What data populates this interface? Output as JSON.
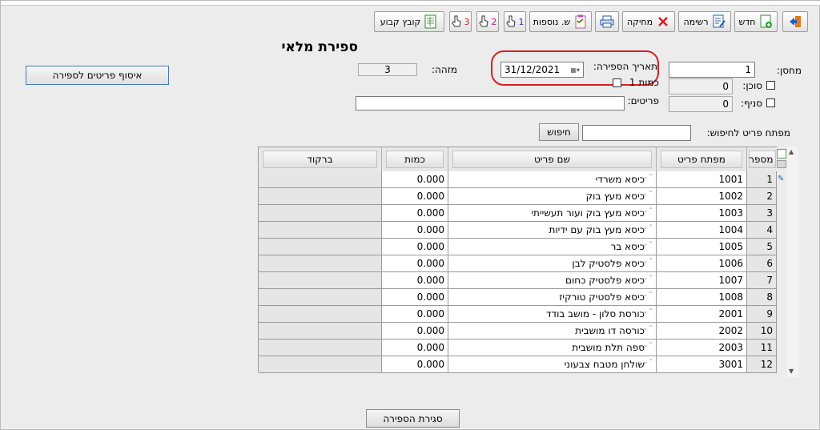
{
  "toolbar": {
    "exit_icon": "exit-door-icon",
    "new_label": "חדש",
    "list_label": "רשימה",
    "delete_label": "מחיקה",
    "print_icon": "printer-icon",
    "more_fields_label": "ש. נוספות",
    "hand1_label": "1",
    "hand2_label": "2",
    "hand3_label": "3",
    "fixed_file_label": "קובץ קבוע"
  },
  "form": {
    "title": "ספירת מלאי",
    "collect_items_button": "איסוף פריטים לספירה",
    "warehouse_label": "מחסן:",
    "warehouse_value": "1",
    "agent_label": "סוכן:",
    "agent_value": "0",
    "branch_label": "סניף:",
    "branch_value": "0",
    "count_date_label": "תאריך הספירה:",
    "count_date_value": "31/12/2021",
    "quantity1_label": "כמות 1",
    "id_label": "מזהה:",
    "id_value": "3",
    "items_label": "פריטים:",
    "items_value": "",
    "search_key_label": "מפתח פריט לחיפוש:",
    "search_key_value": "",
    "search_button": "חיפוש",
    "close_count_button": "סגירת הספירה"
  },
  "table": {
    "headers": {
      "num": "מספר",
      "key": "מפתח פריט",
      "name": "שם פריט",
      "qty": "כמות",
      "barcode": "ברקוד"
    },
    "rows": [
      {
        "num": "1",
        "key": "1001",
        "name": "כיסא משרדי",
        "qty": "0.000",
        "barcode": ""
      },
      {
        "num": "2",
        "key": "1002",
        "name": "כיסא מעץ בוק",
        "qty": "0.000",
        "barcode": ""
      },
      {
        "num": "3",
        "key": "1003",
        "name": "כיסא מעץ בוק ועור תעשייתי",
        "qty": "0.000",
        "barcode": ""
      },
      {
        "num": "4",
        "key": "1004",
        "name": "כיסא מעץ בוק עם ידיות",
        "qty": "0.000",
        "barcode": ""
      },
      {
        "num": "5",
        "key": "1005",
        "name": "כיסא בר",
        "qty": "0.000",
        "barcode": ""
      },
      {
        "num": "6",
        "key": "1006",
        "name": "כיסא פלסטיק לבן",
        "qty": "0.000",
        "barcode": ""
      },
      {
        "num": "7",
        "key": "1007",
        "name": "כיסא פלסטיק כחום",
        "qty": "0.000",
        "barcode": ""
      },
      {
        "num": "8",
        "key": "1008",
        "name": "כיסא פלסטיק טורקיז",
        "qty": "0.000",
        "barcode": ""
      },
      {
        "num": "9",
        "key": "2001",
        "name": "כורסת סלון - מושב בודד",
        "qty": "0.000",
        "barcode": ""
      },
      {
        "num": "10",
        "key": "2002",
        "name": "כורסה דו מושבית",
        "qty": "0.000",
        "barcode": ""
      },
      {
        "num": "11",
        "key": "2003",
        "name": "ספה תלת מושבית",
        "qty": "0.000",
        "barcode": ""
      },
      {
        "num": "12",
        "key": "3001",
        "name": "שולחן מטבח צבעוני",
        "qty": "0.000",
        "barcode": ""
      }
    ]
  },
  "colors": {
    "highlight_ring": "#d62020",
    "window_bg": "#ececec"
  }
}
